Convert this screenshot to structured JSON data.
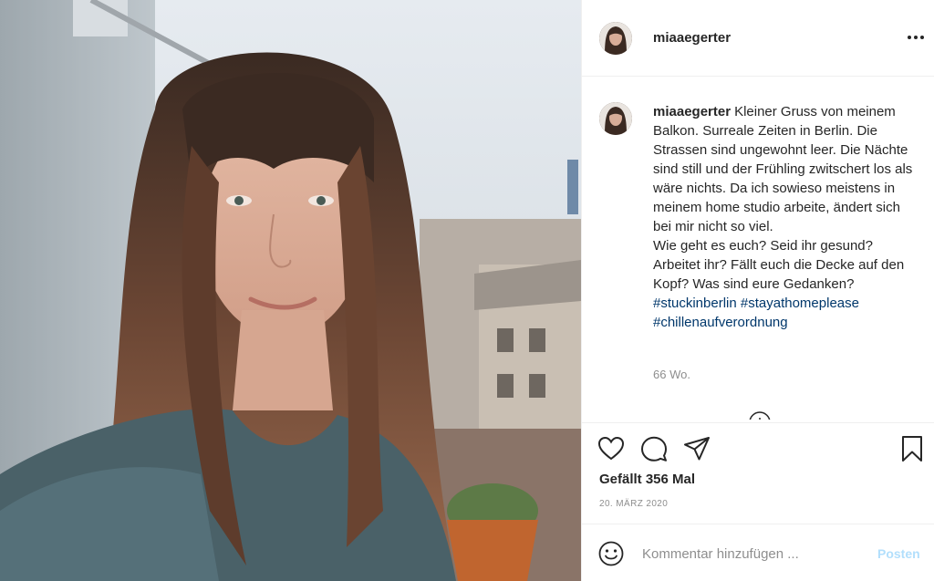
{
  "post": {
    "image_alt": "Selfie photo on a balcony",
    "username": "miaaegerter",
    "caption_lines": [
      "Kleiner Gruss von meinem Balkon. Surreale Zeiten in Berlin. Die Strassen sind ungewohnt leer. Die Nächte sind still und der Frühling zwitschert los als wäre nichts. Da ich sowieso meistens in meinem home studio arbeite, ändert sich bei mir nicht so viel.",
      "Wie geht es euch? Seid ihr gesund? Arbeitet ihr? Fällt euch die Decke auf den Kopf? Was sind eure Gedanken?"
    ],
    "hashtags": [
      "#stuckinberlin",
      "#stayathomeplease",
      "#chillenaufverordnung"
    ],
    "time_ago": "66 Wo.",
    "likes": "Gefällt 356 Mal",
    "date": "20. MÄRZ 2020"
  },
  "comment": {
    "placeholder": "Kommentar hinzufügen ...",
    "post_label": "Posten"
  },
  "icons": {
    "more": "more-options-icon",
    "like": "heart-icon",
    "comment": "comment-bubble-icon",
    "share": "paper-plane-icon",
    "save": "bookmark-icon",
    "emoji": "smiley-icon",
    "load_more": "plus-circle-icon"
  },
  "colors": {
    "text": "#262626",
    "secondary": "#8e8e8e",
    "link": "#00376b",
    "post_button_disabled": "#b2dffc",
    "border": "#efefef"
  }
}
